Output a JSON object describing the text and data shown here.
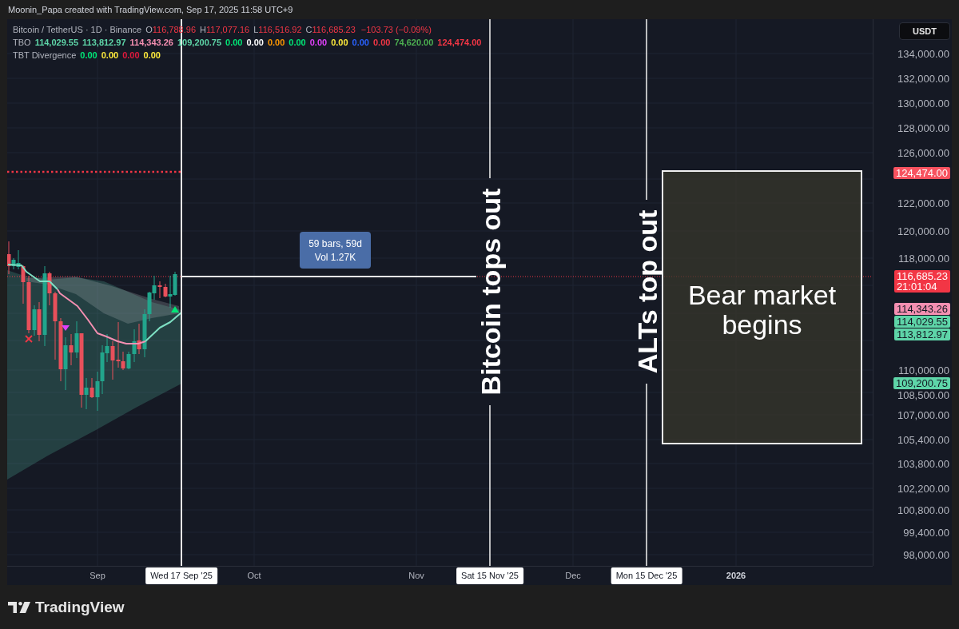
{
  "credit": "Moonin_Papa created with TradingView.com, Sep 17, 2025 11:58 UTC+9",
  "legend": {
    "symbol": "Bitcoin / TetherUS · 1D · Binance",
    "ohlc": [
      {
        "label": "O",
        "value": "116,788.96"
      },
      {
        "label": "H",
        "value": "117,077.16"
      },
      {
        "label": "L",
        "value": "116,516.92"
      },
      {
        "label": "C",
        "value": "116,685.23"
      }
    ],
    "change": "−103.73 (−0.09%)",
    "indicators": [
      {
        "name": "TBO",
        "values": [
          {
            "text": "114,029.55",
            "color": "#5ed5a8"
          },
          {
            "text": "113,812.97",
            "color": "#5ed5a8"
          },
          {
            "text": "114,343.26",
            "color": "#f48fb1"
          },
          {
            "text": "109,200.75",
            "color": "#5ed5a8"
          },
          {
            "text": "0.00",
            "color": "#00e676"
          },
          {
            "text": "0.00",
            "color": "#ffffff"
          },
          {
            "text": "0.00",
            "color": "#ff9800"
          },
          {
            "text": "0.00",
            "color": "#00e676"
          },
          {
            "text": "0.00",
            "color": "#e040fb"
          },
          {
            "text": "0.00",
            "color": "#ffeb3b"
          },
          {
            "text": "0.00",
            "color": "#2962ff"
          },
          {
            "text": "0.00",
            "color": "#f23645"
          },
          {
            "text": "74,620.00",
            "color": "#4caf50"
          },
          {
            "text": "124,474.00",
            "color": "#f23645"
          }
        ]
      },
      {
        "name": "TBT Divergence",
        "values": [
          {
            "text": "0.00",
            "color": "#00e676"
          },
          {
            "text": "0.00",
            "color": "#ffeb3b"
          },
          {
            "text": "0.00",
            "color": "#e0183c"
          },
          {
            "text": "0.00",
            "color": "#ffeb3b"
          }
        ]
      }
    ]
  },
  "chart": {
    "measurement": {
      "range": "59 bars, 59d",
      "volume": "Vol 1.27K"
    },
    "vertical_lines": [
      {
        "label": "Bitcoin tops out"
      },
      {
        "label": "ALTs top out"
      }
    ],
    "box": {
      "label": "Bear market begins"
    }
  },
  "price_axis": {
    "currency": "USDT",
    "labels": [
      "134,000.00",
      "132,000.00",
      "130,000.00",
      "128,000.00",
      "126,000.00",
      "122,000.00",
      "120,000.00",
      "118,000.00",
      "110,000.00",
      "108,500.00",
      "107,000.00",
      "105,400.00",
      "103,800.00",
      "102,200.00",
      "100,800.00",
      "99,400.00",
      "98,000.00"
    ],
    "badges": [
      {
        "text": "124,474.00",
        "color": "#f7525f"
      },
      {
        "text": "116,685.23",
        "countdown": "21:01:04",
        "color": "#f23645"
      },
      {
        "text": "114,343.26",
        "color": "#f48fb1"
      },
      {
        "text": "114,029.55",
        "color": "#5ed5a8"
      },
      {
        "text": "113,812.97",
        "color": "#5ed5a8"
      },
      {
        "text": "109,200.75",
        "color": "#5ed5a8"
      }
    ]
  },
  "time_axis": {
    "labels": [
      {
        "text": "Sep",
        "kind": "month"
      },
      {
        "text": "Oct",
        "kind": "month"
      },
      {
        "text": "Nov",
        "kind": "month"
      },
      {
        "text": "Dec",
        "kind": "month"
      },
      {
        "text": "2026",
        "kind": "year"
      }
    ],
    "markers": [
      "Wed 17 Sep '25",
      "Sat 15 Nov '25",
      "Mon 15 Dec '25"
    ]
  },
  "footer": {
    "brand": "TradingView"
  }
}
